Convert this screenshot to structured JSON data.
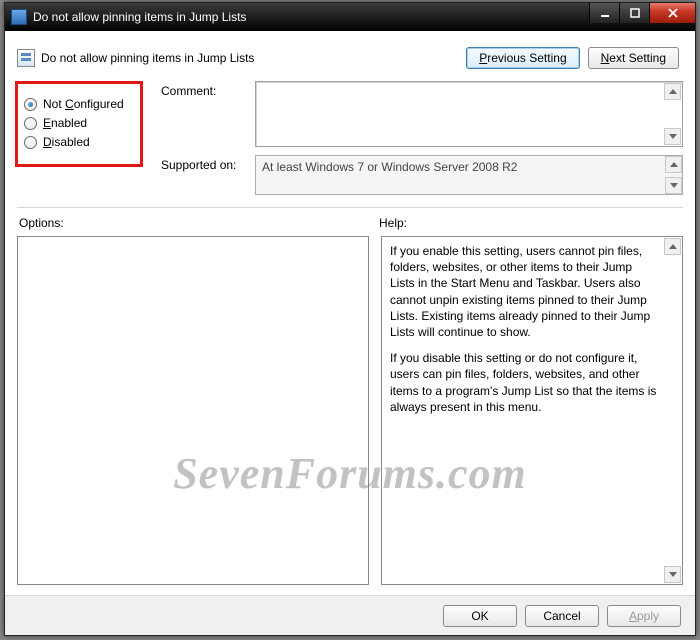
{
  "window": {
    "title": "Do not allow pinning items in Jump Lists"
  },
  "header": {
    "title": "Do not allow pinning items in Jump Lists",
    "prev_label": "Previous Setting",
    "prev_underline": "P",
    "next_label": "Next Setting",
    "next_underline": "N"
  },
  "state": {
    "options": [
      {
        "label": "Not Configured",
        "underline": "C",
        "checked": true
      },
      {
        "label": "Enabled",
        "underline": "E",
        "checked": false
      },
      {
        "label": "Disabled",
        "underline": "D",
        "checked": false
      }
    ]
  },
  "labels": {
    "comment": "Comment:",
    "supported": "Supported on:",
    "options": "Options:",
    "help": "Help:"
  },
  "supported_text": "At least Windows 7 or Windows Server 2008 R2",
  "help_text_p1": "If you enable this setting, users cannot pin files, folders, websites, or other items to their Jump Lists in the Start Menu and Taskbar. Users also cannot unpin existing items pinned to their Jump Lists. Existing items already pinned to their Jump Lists will continue to show.",
  "help_text_p2": "If you disable this setting or do not configure it, users can pin files, folders, websites, and other items to a program's Jump List so that the items is always present in this menu.",
  "buttons": {
    "ok": "OK",
    "cancel": "Cancel",
    "apply": "Apply",
    "apply_underline": "A"
  },
  "watermark": "SevenForums.com"
}
